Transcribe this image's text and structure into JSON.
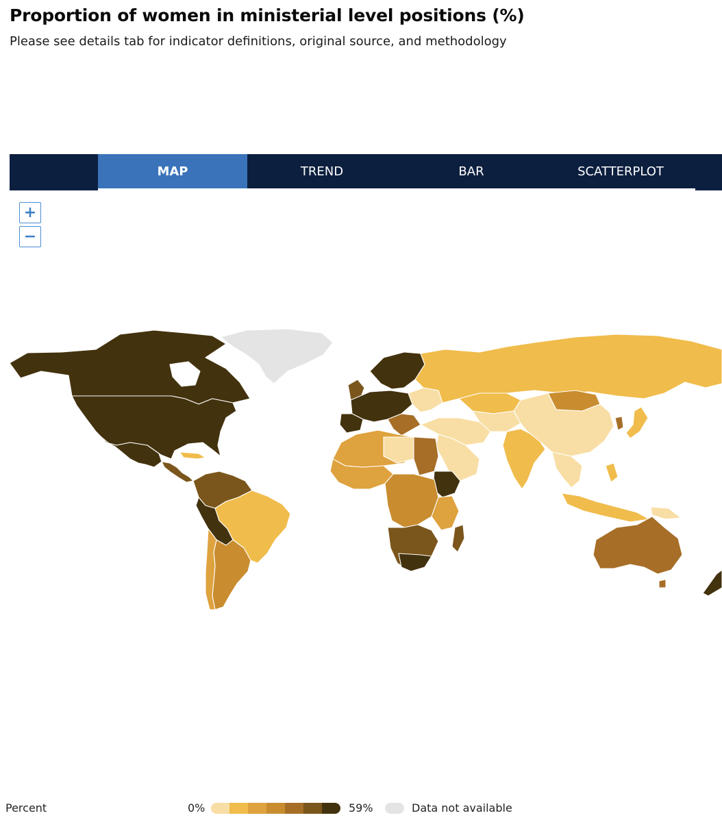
{
  "header": {
    "title": "Proportion of women in ministerial level positions (%)",
    "subtitle": "Please see details tab for indicator definitions, original source, and methodology"
  },
  "tabs": [
    {
      "label": "MAP",
      "active": true
    },
    {
      "label": "TREND",
      "active": false
    },
    {
      "label": "BAR",
      "active": false
    },
    {
      "label": "SCATTERPLOT",
      "active": false
    }
  ],
  "zoom": {
    "in_label": "+",
    "out_label": "−"
  },
  "legend": {
    "title": "Percent",
    "min_label": "0%",
    "max_label": "59%",
    "na_label": "Data not available",
    "scale_colors": [
      "#f8dea4",
      "#f0bc4b",
      "#dea23e",
      "#c98d30",
      "#a66e27",
      "#7b561c",
      "#43320e"
    ],
    "na_color": "#e4e4e4"
  },
  "colors": {
    "tab_bar": "#0d1f3f",
    "tab_active": "#3a73ba",
    "zoom_accent": "#3d7fc4"
  }
}
